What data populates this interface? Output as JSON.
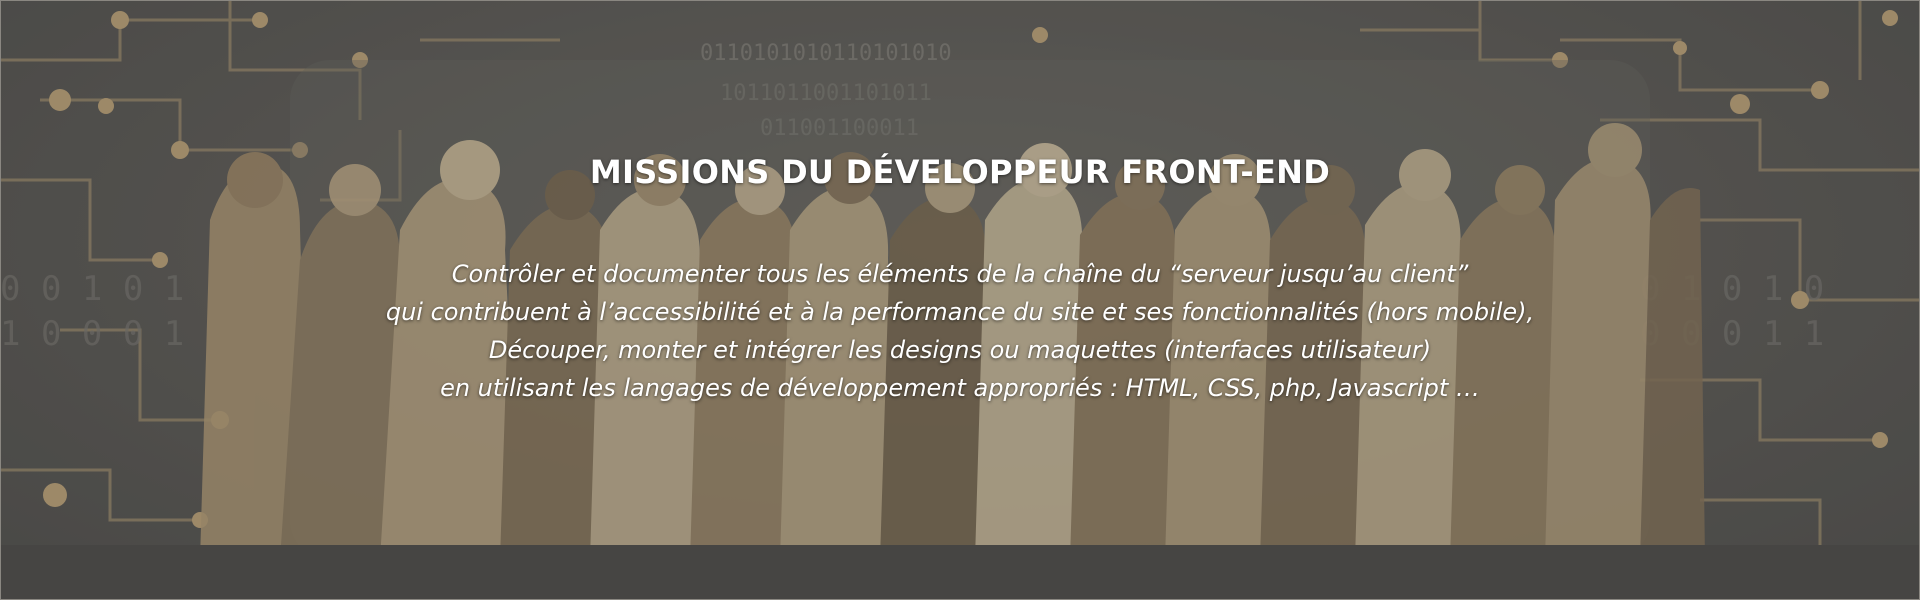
{
  "banner": {
    "title": "MISSIONS DU DÉVELOPPEUR FRONT-END",
    "lines": [
      "Contrôler et documenter tous les éléments de la chaîne du “serveur jusqu’au client”",
      "qui contribuent à l’accessibilité et à la performance du site et ses fonctionnalités (hors mobile),",
      "Découper, monter et intégrer les designs ou maquettes (interfaces utilisateur)",
      "en utilisant les langages de développement appropriés : HTML, CSS, php, Javascript …"
    ],
    "colors": {
      "background": "#5b5a58",
      "circuit": "#c3a77a",
      "text": "#ffffff"
    },
    "background_image": "crowd-of-professionals-over-binary-circuit-board-illustration"
  }
}
